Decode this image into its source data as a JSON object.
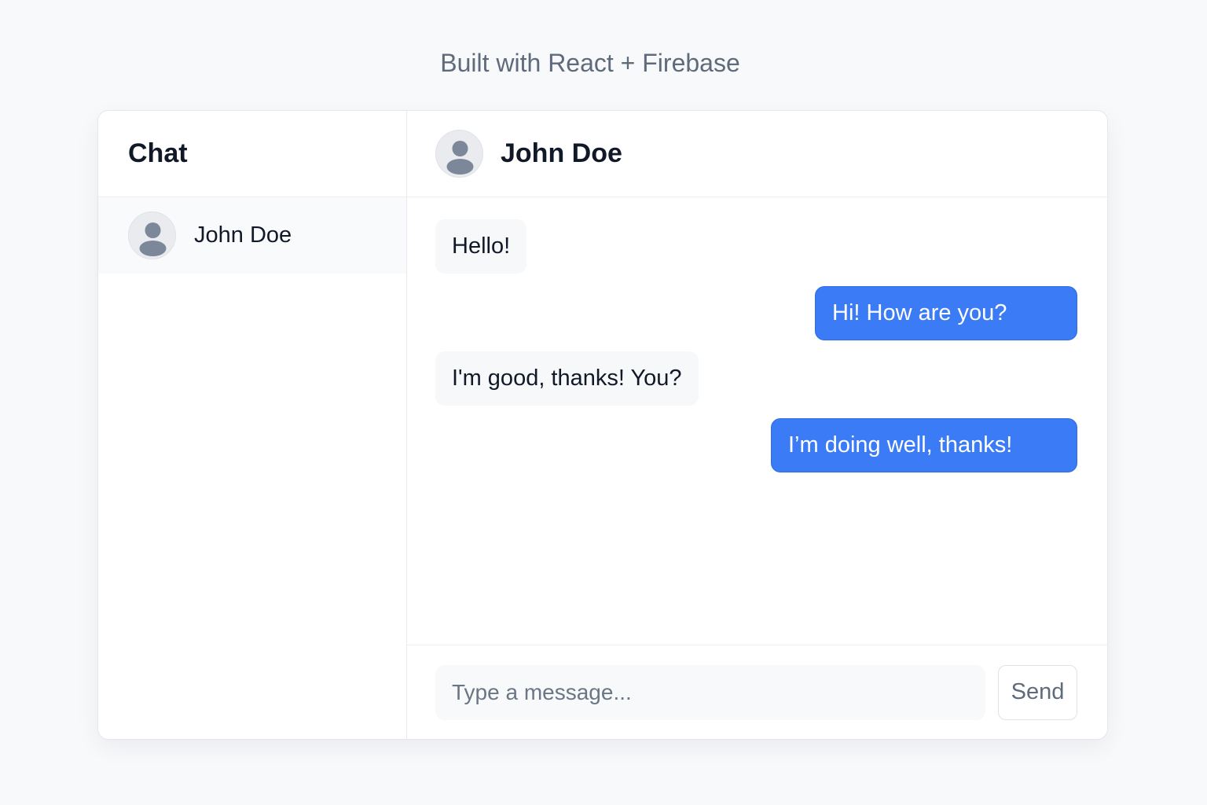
{
  "page": {
    "tagline": "Built with React + Firebase"
  },
  "sidebar": {
    "title": "Chat",
    "contacts": [
      {
        "name": "John Doe",
        "avatar_icon": "user-avatar-icon"
      }
    ]
  },
  "chat": {
    "header": {
      "name": "John Doe",
      "avatar_icon": "user-avatar-icon"
    },
    "messages": [
      {
        "direction": "incoming",
        "text": "Hello!"
      },
      {
        "direction": "outgoing",
        "text": "Hi! How are you?"
      },
      {
        "direction": "incoming",
        "text": "I'm good, thanks! You?"
      },
      {
        "direction": "outgoing",
        "text": "I’m doing well, thanks!"
      }
    ],
    "composer": {
      "placeholder": "Type a message...",
      "value": "",
      "send_label": "Send"
    }
  },
  "colors": {
    "accent": "#3b7bf5",
    "incoming_bubble": "#f7f8fa",
    "page_background": "#f8f9fb",
    "avatar_icon": "#7c8799"
  }
}
